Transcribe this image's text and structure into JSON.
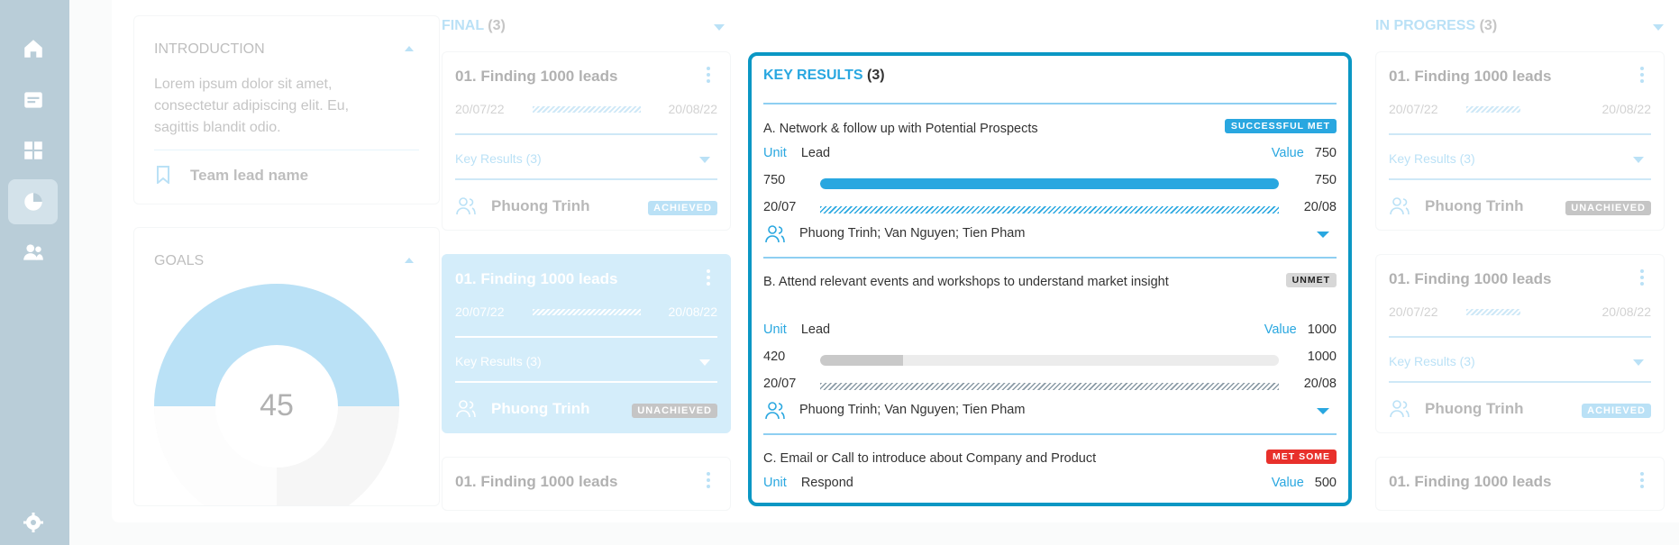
{
  "sidebar": {
    "items": [
      {
        "icon": "home-icon"
      },
      {
        "icon": "inbox-icon"
      },
      {
        "icon": "dashboard-icon"
      },
      {
        "icon": "pie-chart-icon",
        "active": true
      },
      {
        "icon": "users-icon"
      }
    ],
    "settings_icon": "gear-icon"
  },
  "introduction": {
    "title": "INTRODUCTION",
    "text": "Lorem ipsum dolor sit amet, consectetur adipiscing elit. Eu, sagittis blandit odio.",
    "team_lead": "Team lead name"
  },
  "goals": {
    "title": "GOALS",
    "value": "45",
    "fraction": 0.45
  },
  "columns": [
    {
      "title": "FINAL",
      "count": "(3)",
      "cards": [
        {
          "title": "01. Finding 1000 leads",
          "start": "20/07/22",
          "end": "20/08/22",
          "key_results": "Key Results (3)",
          "person": "Phuong Trinh",
          "badge": "ACHIEVED"
        },
        {
          "title": "01. Finding 1000 leads",
          "start": "20/07/22",
          "end": "20/08/22",
          "key_results": "Key Results (3)",
          "person": "Phuong Trinh",
          "badge": "UNACHIEVED"
        },
        {
          "title": "01. Finding 1000 leads"
        }
      ]
    },
    {
      "title": "IN PROGRESS",
      "count": "(3)",
      "cards": [
        {
          "title": "01. Finding 1000 leads",
          "start": "20/07/22",
          "end": "20/08/22",
          "key_results": "Key Results (3)",
          "person": "Phuong Trinh",
          "badge": "UNACHIEVED"
        },
        {
          "title": "01. Finding 1000 leads",
          "start": "20/07/22",
          "end": "20/08/22",
          "key_results": "Key Results (3)",
          "person": "Phuong Trinh",
          "badge": "ACHIEVED"
        },
        {
          "title": "01. Finding 1000 leads"
        }
      ]
    }
  ],
  "key_results": {
    "title": "KEY RESULTS",
    "count": "(3)",
    "colors": {
      "accent": "#29a7e0",
      "border": "#0b97c4",
      "success": "#29a7e0",
      "unmet": "#d7d7d7",
      "met_some": "#e8302b"
    },
    "items": [
      {
        "title": "A. Network & follow up with Potential Prospects",
        "badge": "SUCCESSFUL MET",
        "unit_label": "Unit",
        "unit": "Lead",
        "value_label": "Value",
        "value": "750",
        "current": "750",
        "target": "750",
        "progress": 1.0,
        "start": "20/07",
        "end": "20/08",
        "people": "Phuong Trinh; Van Nguyen; Tien Pham"
      },
      {
        "title": "B. Attend relevant events and workshops to understand market insight",
        "badge": "UNMET",
        "unit_label": "Unit",
        "unit": "Lead",
        "value_label": "Value",
        "value": "1000",
        "current": "420",
        "target": "1000",
        "progress": 0.18,
        "start": "20/07",
        "end": "20/08",
        "people": "Phuong Trinh; Van Nguyen; Tien Pham"
      },
      {
        "title": "C. Email or Call to introduce about Company and Product",
        "badge": "MET SOME",
        "unit_label": "Unit",
        "unit": "Respond",
        "value_label": "Value",
        "value": "500"
      }
    ]
  }
}
